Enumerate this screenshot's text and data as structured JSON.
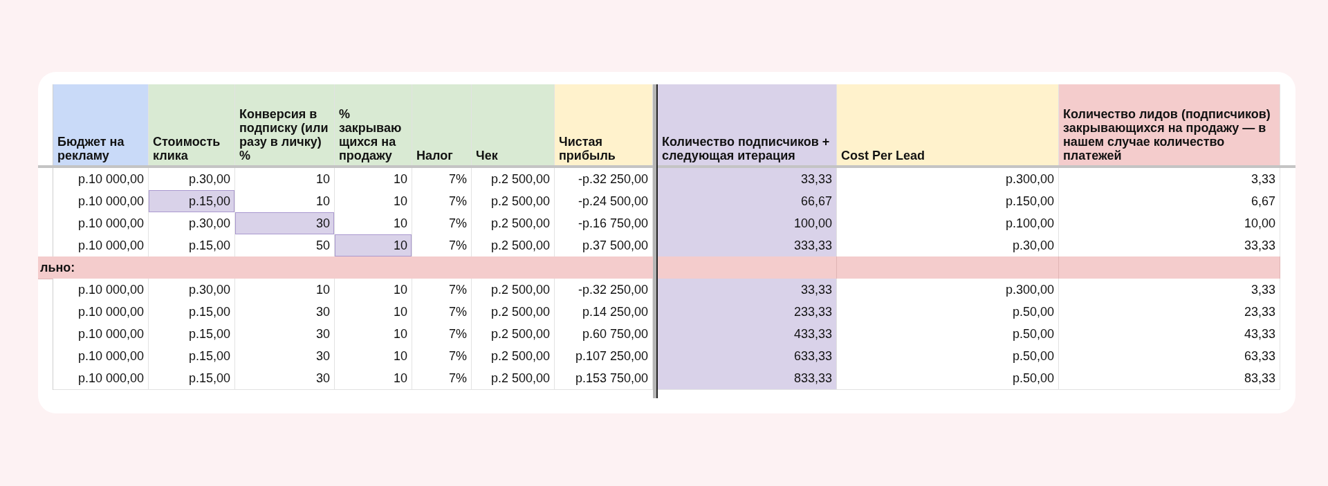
{
  "sheet": {
    "columns": [
      {
        "label": "Бюджет на рекламу",
        "color": "#c9daf8",
        "shaded": false
      },
      {
        "label": "Стоимость клика",
        "color": "#d9ead3",
        "shaded": false
      },
      {
        "label": "Конверсия в подписку (или разу в личку) %",
        "color": "#d9ead3",
        "shaded": false
      },
      {
        "label": "% закрываю щихся на продажу",
        "color": "#d9ead3",
        "shaded": false
      },
      {
        "label": "Налог",
        "color": "#d9ead3",
        "shaded": false
      },
      {
        "label": "Чек",
        "color": "#d9ead3",
        "shaded": false
      },
      {
        "label": "Чистая прибыль",
        "color": "#fff2cc",
        "shaded": false
      },
      {
        "label": "Количество подписчиков + следующая итерация",
        "color": "#d9d2e9",
        "shaded": true
      },
      {
        "label": "Cost Per Lead",
        "color": "#fff2cc",
        "shaded": false
      },
      {
        "label": "Количество лидов (подписчиков) закрывающихся на продажу — в нашем случае количество платежей",
        "color": "#f4cccc",
        "shaded": false
      }
    ],
    "rows": [
      {
        "kind": "data",
        "cells": [
          "р.10 000,00",
          "р.30,00",
          "10",
          "10",
          "7%",
          "р.2 500,00",
          "-р.32 250,00",
          "33,33",
          "р.300,00",
          "3,33"
        ],
        "highlighted": [
          false,
          false,
          false,
          false,
          false,
          false,
          false,
          false,
          false,
          false
        ]
      },
      {
        "kind": "data",
        "cells": [
          "р.10 000,00",
          "р.15,00",
          "10",
          "10",
          "7%",
          "р.2 500,00",
          "-р.24 500,00",
          "66,67",
          "р.150,00",
          "6,67"
        ],
        "highlighted": [
          false,
          true,
          false,
          false,
          false,
          false,
          false,
          false,
          false,
          false
        ]
      },
      {
        "kind": "data",
        "cells": [
          "р.10 000,00",
          "р.30,00",
          "30",
          "10",
          "7%",
          "р.2 500,00",
          "-р.16 750,00",
          "100,00",
          "р.100,00",
          "10,00"
        ],
        "highlighted": [
          false,
          false,
          true,
          false,
          false,
          false,
          false,
          false,
          false,
          false
        ]
      },
      {
        "kind": "data",
        "cells": [
          "р.10 000,00",
          "р.15,00",
          "50",
          "10",
          "7%",
          "р.2 500,00",
          "р.37 500,00",
          "333,33",
          "р.30,00",
          "33,33"
        ],
        "highlighted": [
          false,
          false,
          false,
          true,
          false,
          false,
          false,
          false,
          false,
          false
        ]
      },
      {
        "kind": "section",
        "label": "льно:"
      },
      {
        "kind": "data",
        "cells": [
          "р.10 000,00",
          "р.30,00",
          "10",
          "10",
          "7%",
          "р.2 500,00",
          "-р.32 250,00",
          "33,33",
          "р.300,00",
          "3,33"
        ],
        "highlighted": [
          false,
          false,
          false,
          false,
          false,
          false,
          false,
          false,
          false,
          false
        ]
      },
      {
        "kind": "data",
        "cells": [
          "р.10 000,00",
          "р.15,00",
          "30",
          "10",
          "7%",
          "р.2 500,00",
          "р.14 250,00",
          "233,33",
          "р.50,00",
          "23,33"
        ],
        "highlighted": [
          false,
          false,
          false,
          false,
          false,
          false,
          false,
          false,
          false,
          false
        ]
      },
      {
        "kind": "data",
        "cells": [
          "р.10 000,00",
          "р.15,00",
          "30",
          "10",
          "7%",
          "р.2 500,00",
          "р.60 750,00",
          "433,33",
          "р.50,00",
          "43,33"
        ],
        "highlighted": [
          false,
          false,
          false,
          false,
          false,
          false,
          false,
          false,
          false,
          false
        ]
      },
      {
        "kind": "data",
        "cells": [
          "р.10 000,00",
          "р.15,00",
          "30",
          "10",
          "7%",
          "р.2 500,00",
          "р.107 250,00",
          "633,33",
          "р.50,00",
          "63,33"
        ],
        "highlighted": [
          false,
          false,
          false,
          false,
          false,
          false,
          false,
          false,
          false,
          false
        ]
      },
      {
        "kind": "data",
        "cells": [
          "р.10 000,00",
          "р.15,00",
          "30",
          "10",
          "7%",
          "р.2 500,00",
          "р.153 750,00",
          "833,33",
          "р.50,00",
          "83,33"
        ],
        "highlighted": [
          false,
          false,
          false,
          false,
          false,
          false,
          false,
          false,
          false,
          false
        ]
      }
    ]
  }
}
